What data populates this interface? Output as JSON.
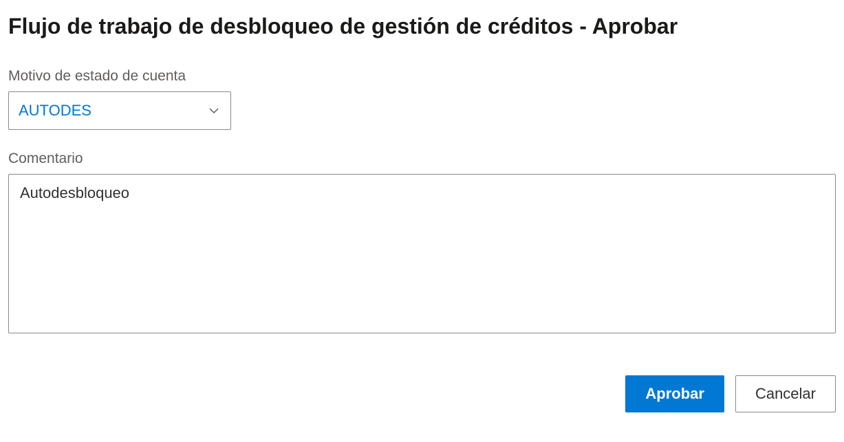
{
  "header": {
    "title": "Flujo de trabajo de desbloqueo de gestión de créditos - Aprobar"
  },
  "fields": {
    "reason": {
      "label": "Motivo de estado de cuenta",
      "value": "AUTODES"
    },
    "comment": {
      "label": "Comentario",
      "value": "Autodesbloqueo"
    }
  },
  "buttons": {
    "approve_label": "Aprobar",
    "cancel_label": "Cancelar"
  }
}
